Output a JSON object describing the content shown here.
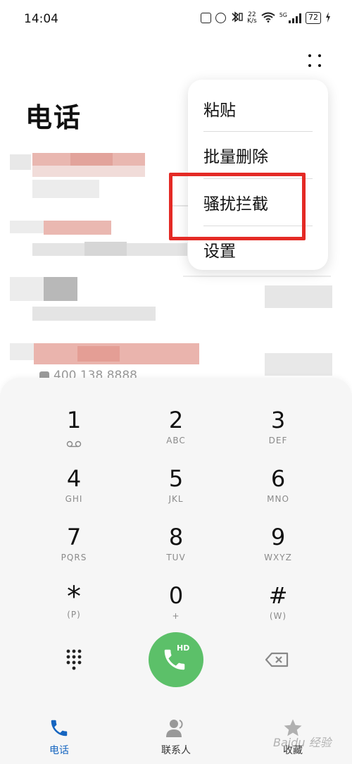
{
  "status_bar": {
    "time": "14:04",
    "network_speed_value": "22",
    "network_speed_unit": "K/s",
    "network_type": "5G",
    "battery": "72"
  },
  "page": {
    "title": "电话"
  },
  "call_log": {
    "partial_number_text": "400 138 8888"
  },
  "menu": {
    "items": [
      {
        "label": "粘贴"
      },
      {
        "label": "批量删除"
      },
      {
        "label": "骚扰拦截"
      },
      {
        "label": "设置"
      }
    ],
    "highlighted_item": "骚扰拦截",
    "highlight_color": "#e42a25"
  },
  "dialpad": {
    "keys": [
      {
        "digit": "1",
        "letters": ""
      },
      {
        "digit": "2",
        "letters": "ABC"
      },
      {
        "digit": "3",
        "letters": "DEF"
      },
      {
        "digit": "4",
        "letters": "GHI"
      },
      {
        "digit": "5",
        "letters": "JKL"
      },
      {
        "digit": "6",
        "letters": "MNO"
      },
      {
        "digit": "7",
        "letters": "PQRS"
      },
      {
        "digit": "8",
        "letters": "TUV"
      },
      {
        "digit": "9",
        "letters": "WXYZ"
      },
      {
        "digit": "*",
        "letters": "(P)"
      },
      {
        "digit": "0",
        "letters": "+"
      },
      {
        "digit": "#",
        "letters": "(W)"
      }
    ],
    "call_button_label": "HD",
    "call_color": "#5cc069"
  },
  "nav": {
    "tabs": [
      {
        "label": "电话",
        "icon": "phone-icon",
        "active": true
      },
      {
        "label": "联系人",
        "icon": "contacts-icon",
        "active": false
      },
      {
        "label": "收藏",
        "icon": "star-icon",
        "active": false
      }
    ],
    "active_color": "#1565c0"
  },
  "watermark": "Baidu 经验"
}
